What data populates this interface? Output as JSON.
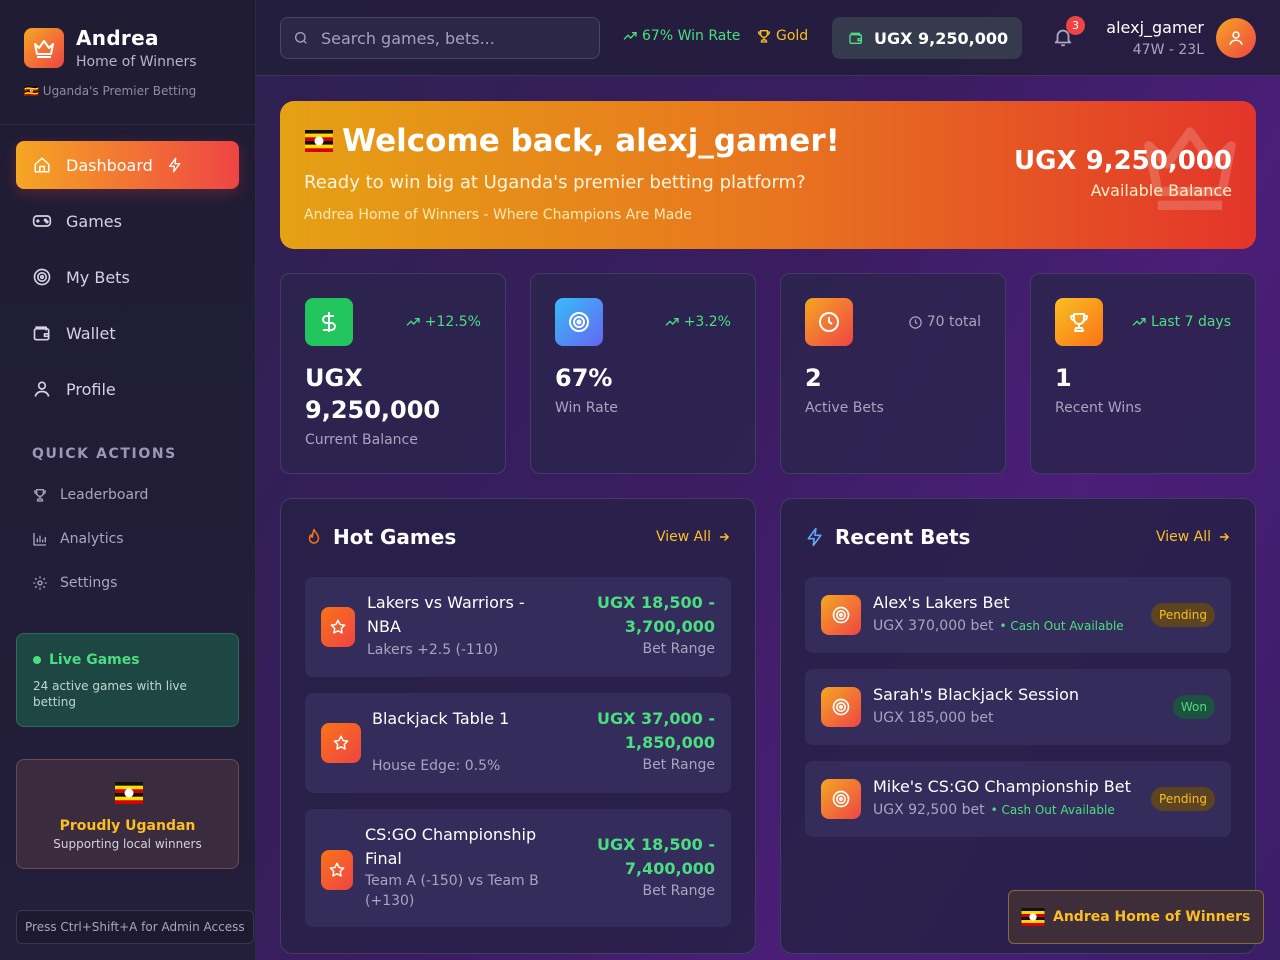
{
  "brand": {
    "name": "Andrea",
    "subtitle": "Home of Winners",
    "tagline": "Uganda's Premier Betting",
    "flag": "🇺🇬"
  },
  "sidebar": {
    "nav": [
      {
        "label": "Dashboard",
        "icon": "home-icon",
        "active": true
      },
      {
        "label": "Games",
        "icon": "gamepad-icon"
      },
      {
        "label": "My Bets",
        "icon": "target-icon"
      },
      {
        "label": "Wallet",
        "icon": "wallet-icon"
      },
      {
        "label": "Profile",
        "icon": "user-icon"
      }
    ],
    "quick_actions_title": "QUICK ACTIONS",
    "quick_actions": [
      {
        "label": "Leaderboard",
        "icon": "trophy-icon"
      },
      {
        "label": "Analytics",
        "icon": "bar-chart-icon"
      },
      {
        "label": "Settings",
        "icon": "gear-icon"
      }
    ],
    "live": {
      "title": "Live Games",
      "text": "24 active games with live betting"
    },
    "proud": {
      "title": "Proudly Ugandan",
      "subtitle": "Supporting local winners"
    },
    "admin_hint": "Press Ctrl+Shift+A for Admin Access"
  },
  "topbar": {
    "search_placeholder": "Search games, bets...",
    "win_rate": "67% Win Rate",
    "tier": "Gold",
    "balance": "UGX 9,250,000",
    "notifications": "3",
    "username": "alexj_gamer",
    "record": "47W - 23L"
  },
  "banner": {
    "title": "Welcome back, alexj_gamer!",
    "subtitle": "Ready to win big at Uganda's premier betting platform?",
    "tagline": "Andrea Home of Winners - Where Champions Are Made",
    "balance": "UGX 9,250,000",
    "balance_label": "Available Balance"
  },
  "stats": [
    {
      "value": "UGX 9,250,000",
      "label": "Current Balance",
      "trend": "+12.5%",
      "icon": "dollar-icon"
    },
    {
      "value": "67%",
      "label": "Win Rate",
      "trend": "+3.2%",
      "icon": "target-icon"
    },
    {
      "value": "2",
      "label": "Active Bets",
      "trend": "70 total",
      "icon": "clock-icon"
    },
    {
      "value": "1",
      "label": "Recent Wins",
      "trend": "Last 7 days",
      "icon": "trophy-icon"
    }
  ],
  "hot_games": {
    "title": "Hot Games",
    "view_all": "View All",
    "items": [
      {
        "name": "Lakers vs Warriors - NBA",
        "detail": "Lakers +2.5 (-110)",
        "range": "UGX 18,500 - 3,700,000",
        "range_label": "Bet Range"
      },
      {
        "name": "Blackjack Table 1",
        "detail": "House Edge: 0.5%",
        "range": "UGX 37,000 - 1,850,000",
        "range_label": "Bet Range"
      },
      {
        "name": "CS:GO Championship Final",
        "detail": "Team A (-150) vs Team B (+130)",
        "range": "UGX 18,500 - 7,400,000",
        "range_label": "Bet Range"
      }
    ]
  },
  "recent_bets": {
    "title": "Recent Bets",
    "view_all": "View All",
    "items": [
      {
        "title": "Alex's Lakers Bet",
        "amount": "UGX 370,000 bet",
        "cash_out": "• Cash Out Available",
        "status": "Pending"
      },
      {
        "title": "Sarah's Blackjack Session",
        "amount": "UGX 185,000 bet",
        "cash_out": "",
        "status": "Won"
      },
      {
        "title": "Mike's CS:GO Championship Bet",
        "amount": "UGX 92,500 bet",
        "cash_out": "• Cash Out Available",
        "status": "Pending"
      }
    ]
  },
  "footer_chip": "Andrea Home of Winners",
  "colors": {
    "accent_gold": "#fbbf24",
    "accent_orange": "#f5a623",
    "accent_red": "#ef4444",
    "success": "#4ade80"
  }
}
